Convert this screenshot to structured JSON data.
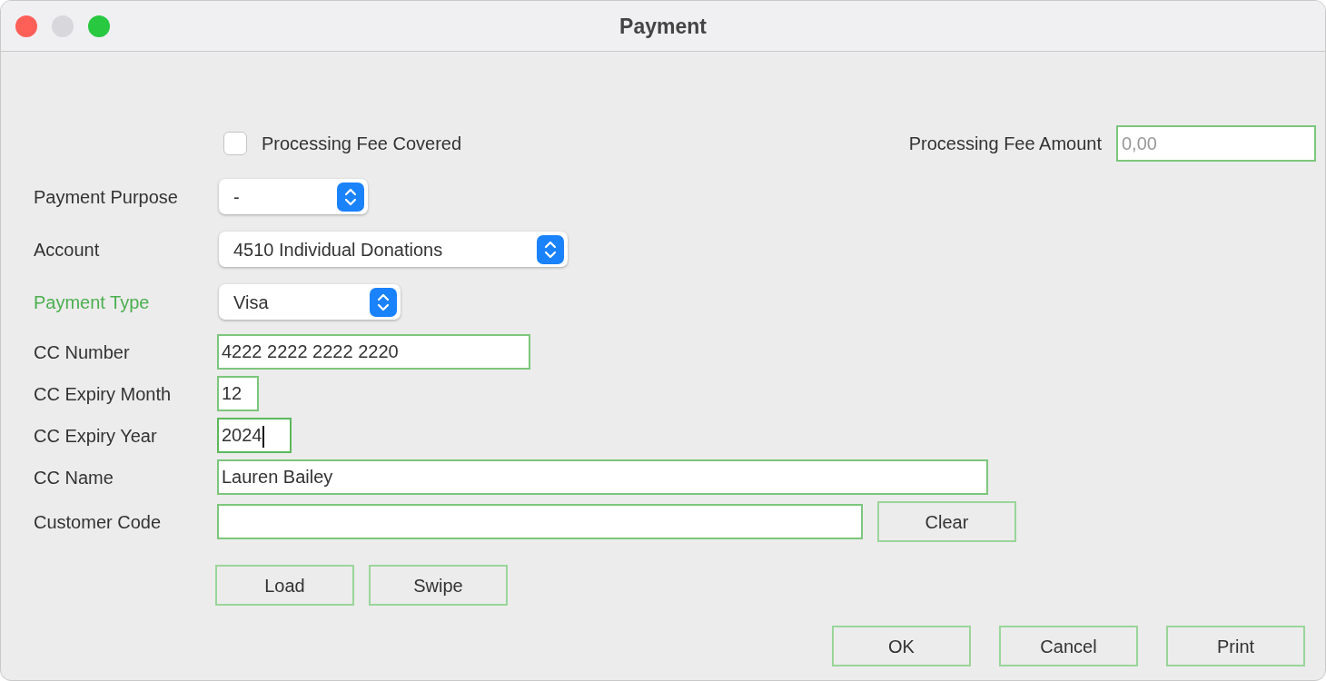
{
  "window": {
    "title": "Payment"
  },
  "fee_covered": {
    "label": "Processing Fee Covered",
    "checked": false
  },
  "fee_amount": {
    "label": "Processing Fee Amount",
    "placeholder": "0,00"
  },
  "fields": [
    {
      "label": "Payment Purpose",
      "kind": "select",
      "value": "-",
      "highlighted": false
    },
    {
      "label": "Account",
      "kind": "select",
      "value": "4510 Individual Donations",
      "highlighted": false
    },
    {
      "label": "Payment Type",
      "kind": "select",
      "value": "Visa",
      "highlighted": true
    },
    {
      "label": "CC Number",
      "kind": "text",
      "value": "4222 2222 2222 2220",
      "highlighted": false,
      "focused": false
    },
    {
      "label": "CC Expiry Month",
      "kind": "text",
      "value": "12",
      "highlighted": false,
      "focused": false
    },
    {
      "label": "CC Expiry Year",
      "kind": "text",
      "value": "2024",
      "highlighted": false,
      "focused": true
    },
    {
      "label": "CC Name",
      "kind": "text",
      "value": "Lauren Bailey",
      "highlighted": false,
      "focused": false
    },
    {
      "label": "Customer Code",
      "kind": "text",
      "highlighted": false,
      "focused": false,
      "button": "Clear"
    }
  ],
  "card_buttons": [
    "Load",
    "Swipe"
  ],
  "dialog_buttons": [
    "OK",
    "Cancel",
    "Print"
  ]
}
